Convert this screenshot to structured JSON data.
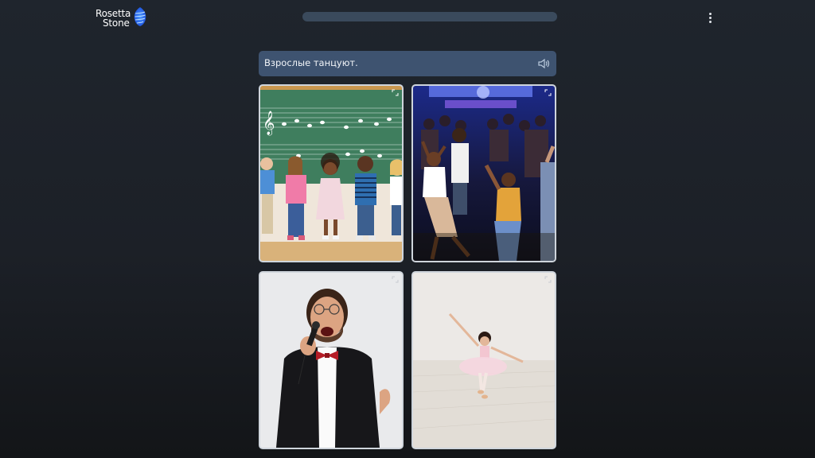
{
  "app": {
    "brand_line1": "Rosetta",
    "brand_line2": "Stone"
  },
  "progress": {
    "fraction": 0.0
  },
  "prompt": {
    "text": "Взрослые танцуют.",
    "icon": "speaker-icon"
  },
  "choices": [
    {
      "id": "children-choir",
      "icon": "expand-icon"
    },
    {
      "id": "adults-dancing",
      "icon": "expand-icon"
    },
    {
      "id": "man-singing",
      "icon": "expand-icon"
    },
    {
      "id": "girl-ballet",
      "icon": "expand-icon"
    }
  ],
  "colors": {
    "accent": "#3e5370",
    "card_border": "#cfd5dc",
    "logo_blue": "#1f6dff"
  }
}
